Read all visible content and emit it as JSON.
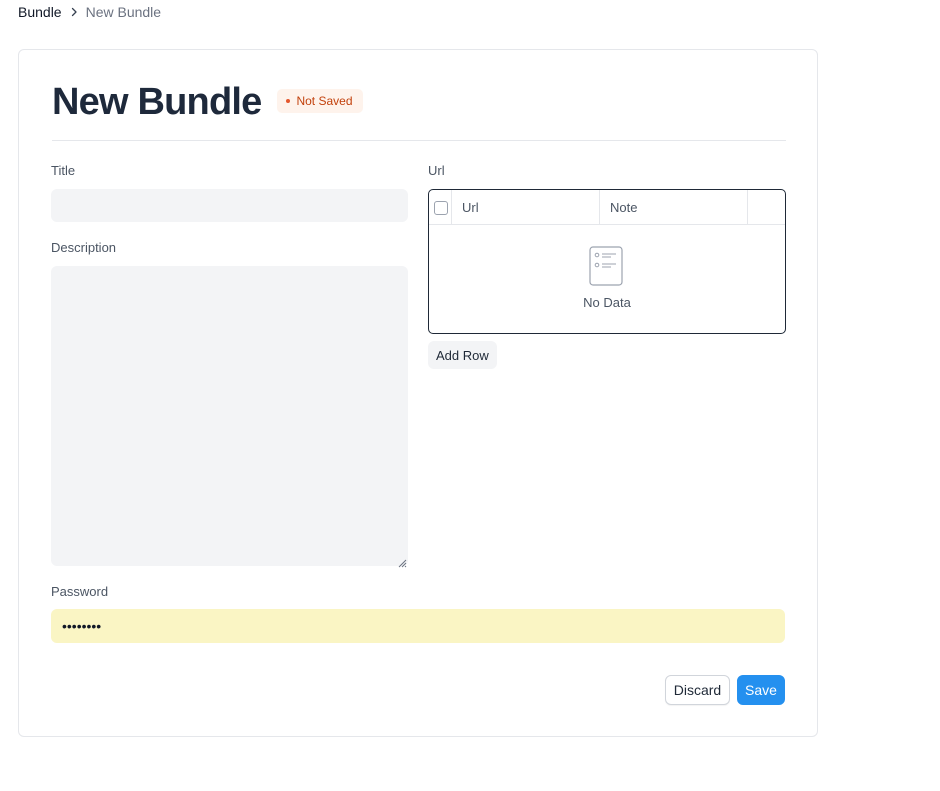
{
  "breadcrumb": {
    "root": "Bundle",
    "separator_icon": "chevron-right-icon",
    "current": "New Bundle"
  },
  "form": {
    "title": "New Bundle",
    "status_badge": "Not Saved",
    "fields": {
      "title_label": "Title",
      "title_value": "",
      "description_label": "Description",
      "description_value": "",
      "password_label": "Password",
      "password_value": "••••••••"
    },
    "url_table": {
      "label": "Url",
      "columns": [
        "Url",
        "Note"
      ],
      "empty_icon": "empty-list-icon",
      "empty_text": "No Data",
      "add_row_label": "Add Row"
    }
  },
  "actions": {
    "discard_label": "Discard",
    "save_label": "Save"
  },
  "colors": {
    "primary": "#2490ef",
    "badge_text": "#c2410c",
    "badge_bg": "#fef3ec",
    "password_bg": "#faf5c4",
    "input_bg": "#f3f4f6"
  }
}
